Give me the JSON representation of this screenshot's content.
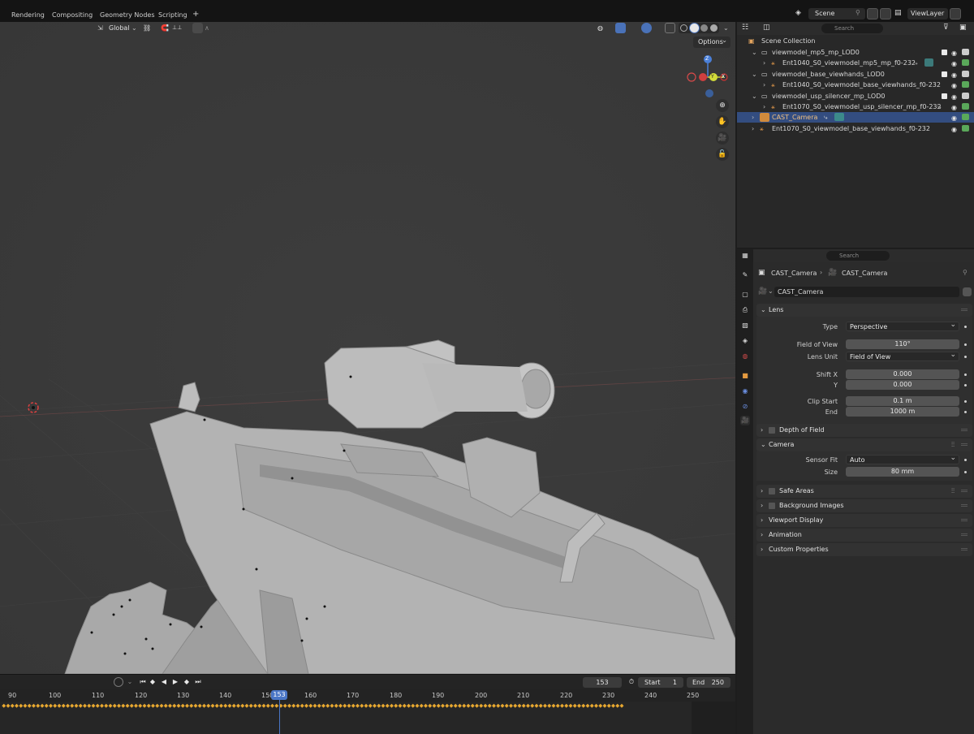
{
  "topbar": {
    "tabs": [
      "Rendering",
      "Compositing",
      "Geometry Nodes",
      "Scripting",
      "+"
    ],
    "scene": "Scene",
    "view_layer": "ViewLayer"
  },
  "viewport": {
    "orientation": "Global",
    "options_label": "Options",
    "gizmo_axes": {
      "x": "X",
      "y": "Y",
      "z": "Z"
    }
  },
  "outliner": {
    "search_placeholder": "Search",
    "rows": [
      {
        "label": "Scene Collection"
      },
      {
        "label": "viewmodel_mp5_mp_LOD0"
      },
      {
        "label": "Ent1040_S0_viewmodel_mp5_mp_f0-232"
      },
      {
        "label": "viewmodel_base_viewhands_LOD0"
      },
      {
        "label": "Ent1040_S0_viewmodel_base_viewhands_f0-232"
      },
      {
        "label": "viewmodel_usp_silencer_mp_LOD0"
      },
      {
        "label": "Ent1070_S0_viewmodel_usp_silencer_mp_f0-232"
      },
      {
        "label": "CAST_Camera"
      },
      {
        "label": "Ent1070_S0_viewmodel_base_viewhands_f0-232"
      }
    ]
  },
  "properties": {
    "search_placeholder": "Search",
    "breadcrumb": [
      "CAST_Camera",
      "CAST_Camera"
    ],
    "datablock_name": "CAST_Camera",
    "panels": {
      "lens": "Lens",
      "dof": "Depth of Field",
      "camera": "Camera",
      "safe_areas": "Safe Areas",
      "background_images": "Background Images",
      "viewport_display": "Viewport Display",
      "animation": "Animation",
      "custom_properties": "Custom Properties"
    },
    "lens": {
      "type_label": "Type",
      "type_value": "Perspective",
      "fov_label": "Field of View",
      "fov_value": "110°",
      "lens_unit_label": "Lens Unit",
      "lens_unit_value": "Field of View",
      "shift_x_label": "Shift X",
      "shift_x_value": "0.000",
      "shift_y_label": "Y",
      "shift_y_value": "0.000",
      "clip_start_label": "Clip Start",
      "clip_start_value": "0.1 m",
      "clip_end_label": "End",
      "clip_end_value": "1000 m"
    },
    "camera": {
      "sensor_fit_label": "Sensor Fit",
      "sensor_fit_value": "Auto",
      "size_label": "Size",
      "size_value": "80 mm"
    }
  },
  "timeline": {
    "current_frame": "153",
    "start_label": "Start",
    "start_value": "1",
    "end_label": "End",
    "end_value": "250",
    "ticks": [
      "90",
      "100",
      "110",
      "120",
      "130",
      "140",
      "150",
      "160",
      "170",
      "180",
      "190",
      "200",
      "210",
      "220",
      "230",
      "240",
      "250"
    ],
    "playhead_label": "153"
  }
}
